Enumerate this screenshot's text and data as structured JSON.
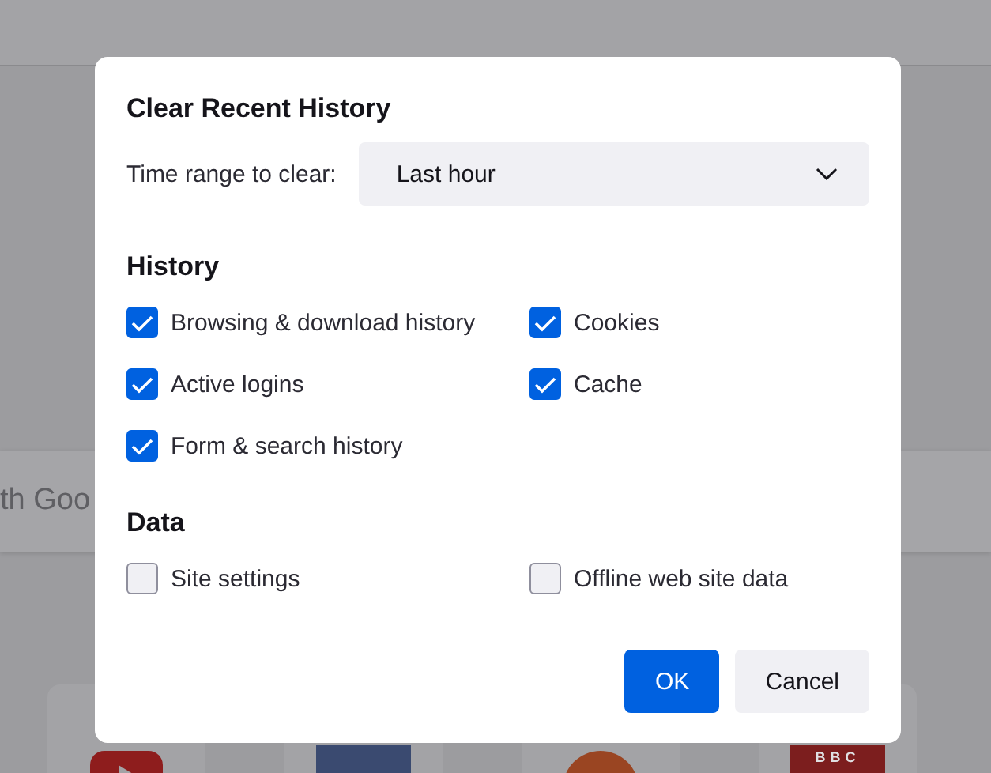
{
  "dialog": {
    "title": "Clear Recent History",
    "time_range": {
      "label": "Time range to clear:",
      "value": "Last hour"
    },
    "sections": [
      {
        "heading": "History",
        "options": [
          {
            "label": "Browsing & download history",
            "checked": true
          },
          {
            "label": "Cookies",
            "checked": true
          },
          {
            "label": "Active logins",
            "checked": true
          },
          {
            "label": "Cache",
            "checked": true
          },
          {
            "label": "Form & search history",
            "checked": true
          }
        ]
      },
      {
        "heading": "Data",
        "options": [
          {
            "label": "Site settings",
            "checked": false
          },
          {
            "label": "Offline web site data",
            "checked": false
          }
        ]
      }
    ],
    "buttons": [
      {
        "label": "OK",
        "kind": "primary"
      },
      {
        "label": "Cancel",
        "kind": "secondary"
      }
    ]
  },
  "background": {
    "search_text": "th Goo",
    "tiles": [
      {
        "kind": "video"
      },
      {
        "kind": "social"
      },
      {
        "kind": "forum"
      },
      {
        "kind": "news",
        "logo_text": "BBC"
      }
    ]
  }
}
